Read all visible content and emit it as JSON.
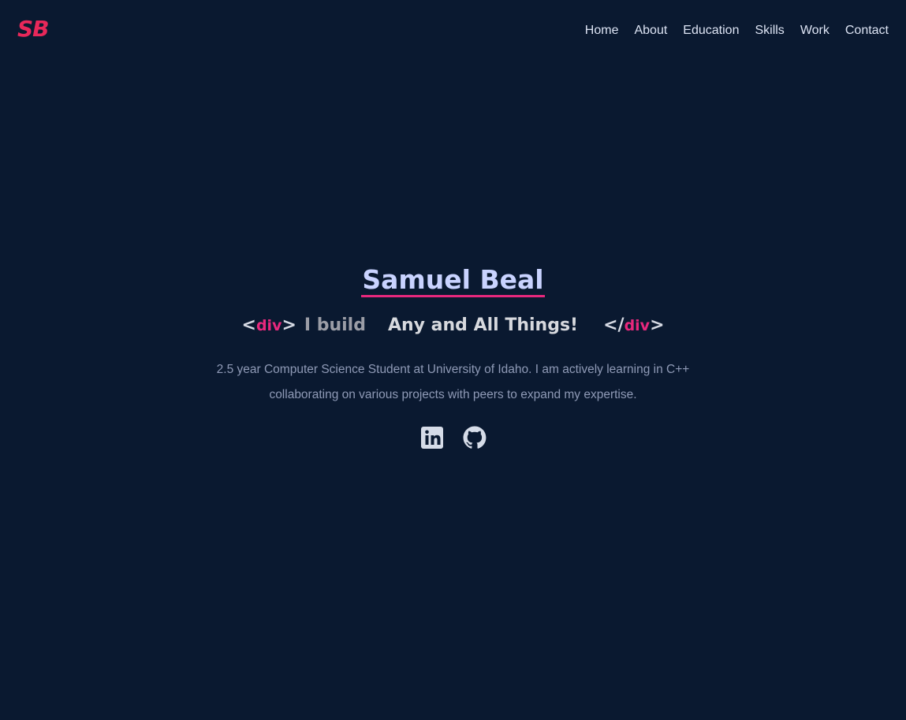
{
  "logo": {
    "text": "SB",
    "color": "#e8285a"
  },
  "nav": {
    "items": [
      {
        "label": "Home"
      },
      {
        "label": "About"
      },
      {
        "label": "Education"
      },
      {
        "label": "Skills"
      },
      {
        "label": "Work"
      },
      {
        "label": "Contact"
      }
    ]
  },
  "hero": {
    "name": "Samuel Beal",
    "tagline": {
      "open_bracket_left": "<",
      "open_tag": "div",
      "open_bracket_right": ">",
      "static_text": "I build",
      "rotating_text": "Any and All Things!",
      "close_bracket_left": "</",
      "close_tag": "div",
      "close_bracket_right": ">"
    },
    "description": "2.5 year Computer Science Student at University of Idaho. I am actively learning in C++ collaborating on various projects with peers to expand my expertise."
  },
  "socials": [
    {
      "icon": "linkedin-icon"
    },
    {
      "icon": "github-icon"
    }
  ],
  "colors": {
    "background": "#0a1930",
    "accent": "#e8287d",
    "name": "#c9d3ff",
    "nav_text": "#dce3f3",
    "description": "#8f9ab6"
  }
}
